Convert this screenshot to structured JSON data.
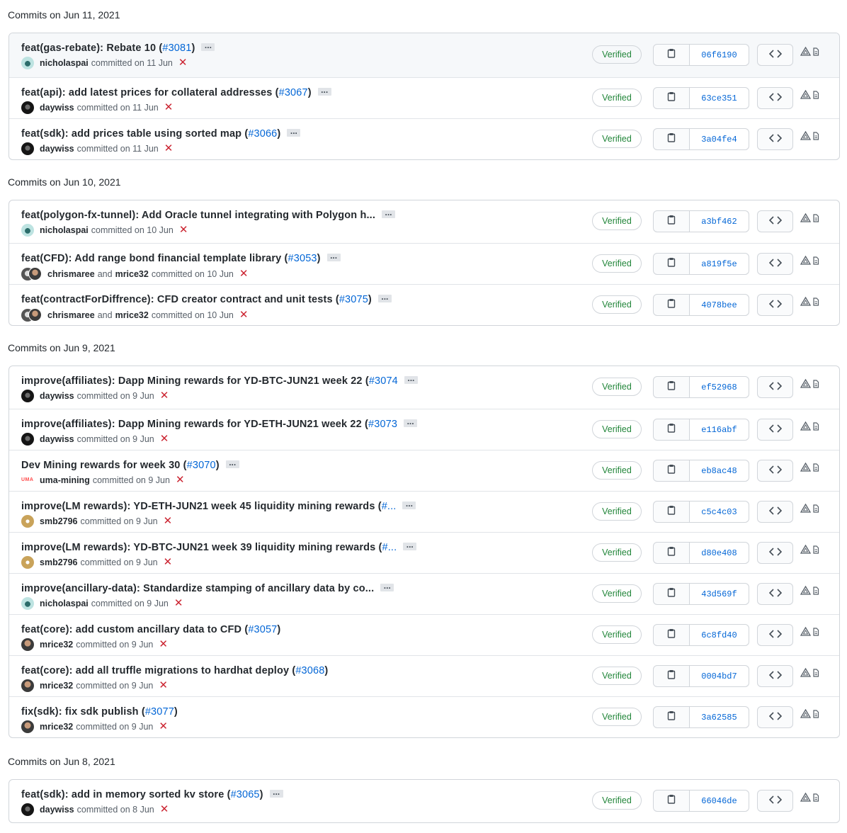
{
  "days": [
    {
      "header": "Commits on Jun 11, 2021",
      "commits": [
        {
          "title": "feat(gas-rebate): Rebate 10 (",
          "pr": "#3081",
          "close": ")",
          "authors": [
            "nicholaspai"
          ],
          "avatars": [
            "nicholaspai"
          ],
          "joiner": "",
          "date": "committed on 11 Jun",
          "status": "Verified",
          "sha": "06f6190",
          "highlight": true
        },
        {
          "title": "feat(api): add latest prices for collateral addresses (",
          "pr": "#3067",
          "close": ")",
          "authors": [
            "daywiss"
          ],
          "avatars": [
            "daywiss"
          ],
          "joiner": "",
          "date": "committed on 11 Jun",
          "status": "Verified",
          "sha": "63ce351"
        },
        {
          "title": "feat(sdk): add prices table using sorted map (",
          "pr": "#3066",
          "close": ")",
          "authors": [
            "daywiss"
          ],
          "avatars": [
            "daywiss"
          ],
          "joiner": "",
          "date": "committed on 11 Jun",
          "status": "Verified",
          "sha": "3a04fe4"
        }
      ]
    },
    {
      "header": "Commits on Jun 10, 2021",
      "commits": [
        {
          "title": "feat(polygon-fx-tunnel): Add Oracle tunnel integrating with Polygon h...",
          "pr": "",
          "close": "",
          "authors": [
            "nicholaspai"
          ],
          "avatars": [
            "nicholaspai"
          ],
          "joiner": "",
          "date": "committed on 10 Jun",
          "status": "Verified",
          "sha": "a3bf462"
        },
        {
          "title": "feat(CFD): Add range bond financial template library (",
          "pr": "#3053",
          "close": ")",
          "authors": [
            "chrismaree",
            "mrice32"
          ],
          "avatars": [
            "chrismaree",
            "mrice32"
          ],
          "joiner": "and",
          "date": "committed on 10 Jun",
          "status": "Verified",
          "sha": "a819f5e"
        },
        {
          "title": "feat(contractForDiffrence): CFD creator contract and unit tests (",
          "pr": "#3075",
          "close": ")",
          "authors": [
            "chrismaree",
            "mrice32"
          ],
          "avatars": [
            "chrismaree",
            "mrice32"
          ],
          "joiner": "and",
          "date": "committed on 10 Jun",
          "status": "Verified",
          "sha": "4078bee"
        }
      ]
    },
    {
      "header": "Commits on Jun 9, 2021",
      "commits": [
        {
          "title": "improve(affiliates): Dapp Mining rewards for YD-BTC-JUN21 week 22 (",
          "pr": "#3074",
          "close": "",
          "authors": [
            "daywiss"
          ],
          "avatars": [
            "daywiss"
          ],
          "joiner": "",
          "date": "committed on 9 Jun",
          "status": "Verified",
          "sha": "ef52968"
        },
        {
          "title": "improve(affiliates): Dapp Mining rewards for YD-ETH-JUN21 week 22 (",
          "pr": "#3073",
          "close": "",
          "authors": [
            "daywiss"
          ],
          "avatars": [
            "daywiss"
          ],
          "joiner": "",
          "date": "committed on 9 Jun",
          "status": "Verified",
          "sha": "e116abf"
        },
        {
          "title": "Dev Mining rewards for week 30 (",
          "pr": "#3070",
          "close": ")",
          "authors": [
            "uma-mining"
          ],
          "avatars": [
            "uma"
          ],
          "joiner": "",
          "date": "committed on 9 Jun",
          "status": "Verified",
          "sha": "eb8ac48"
        },
        {
          "title": "improve(LM rewards): YD-ETH-JUN21 week 45 liquidity mining rewards (",
          "pr": "#...",
          "close": "",
          "authors": [
            "smb2796"
          ],
          "avatars": [
            "smb2796"
          ],
          "joiner": "",
          "date": "committed on 9 Jun",
          "status": "Verified",
          "sha": "c5c4c03"
        },
        {
          "title": "improve(LM rewards): YD-BTC-JUN21 week 39 liquidity mining rewards (",
          "pr": "#...",
          "close": "",
          "authors": [
            "smb2796"
          ],
          "avatars": [
            "smb2796"
          ],
          "joiner": "",
          "date": "committed on 9 Jun",
          "status": "Verified",
          "sha": "d80e408"
        },
        {
          "title": "improve(ancillary-data): Standardize stamping of ancillary data by co...",
          "pr": "",
          "close": "",
          "authors": [
            "nicholaspai"
          ],
          "avatars": [
            "nicholaspai"
          ],
          "joiner": "",
          "date": "committed on 9 Jun",
          "status": "Verified",
          "sha": "43d569f"
        },
        {
          "title": "feat(core): add custom ancillary data to CFD (",
          "pr": "#3057",
          "close": ")",
          "authors": [
            "mrice32"
          ],
          "avatars": [
            "mrice32"
          ],
          "joiner": "",
          "date": "committed on 9 Jun",
          "status": "Verified",
          "sha": "6c8fd40",
          "noEllipsis": true
        },
        {
          "title": "feat(core): add all truffle migrations to hardhat deploy (",
          "pr": "#3068",
          "close": ")",
          "authors": [
            "mrice32"
          ],
          "avatars": [
            "mrice32"
          ],
          "joiner": "",
          "date": "committed on 9 Jun",
          "status": "Verified",
          "sha": "0004bd7",
          "noEllipsis": true
        },
        {
          "title": "fix(sdk): fix sdk publish (",
          "pr": "#3077",
          "close": ")",
          "authors": [
            "mrice32"
          ],
          "avatars": [
            "mrice32"
          ],
          "joiner": "",
          "date": "committed on 9 Jun",
          "status": "Verified",
          "sha": "3a62585",
          "noEllipsis": true
        }
      ]
    },
    {
      "header": "Commits on Jun 8, 2021",
      "commits": [
        {
          "title": "feat(sdk): add in memory sorted kv store (",
          "pr": "#3065",
          "close": ")",
          "authors": [
            "daywiss"
          ],
          "avatars": [
            "daywiss"
          ],
          "joiner": "",
          "date": "committed on 8 Jun",
          "status": "Verified",
          "sha": "66046de"
        }
      ]
    }
  ],
  "uma_logo_text": "UMA",
  "icons": {
    "copy": "clipboard-icon",
    "browse": "code-icon",
    "alert": "alert-icon",
    "fail": "x-icon"
  },
  "colors": {
    "link": "#0366d6",
    "verified": "#22863a",
    "fail": "#cb2431",
    "border": "#d1d5da"
  }
}
